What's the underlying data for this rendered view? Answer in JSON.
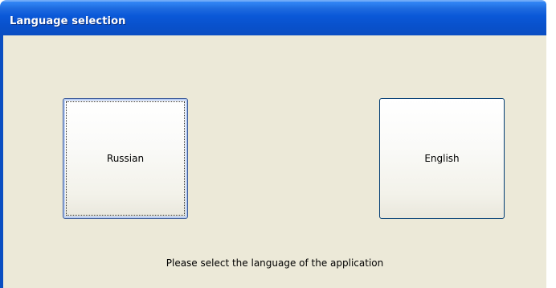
{
  "window": {
    "title": "Language selection"
  },
  "buttons": {
    "russian": "Russian",
    "english": "English"
  },
  "hint": "Please select the language of the application",
  "colors": {
    "titlebar": "#0a58d8",
    "client_background": "#ece9d8",
    "button_border": "#003c74",
    "title_text": "#ffffff"
  },
  "state": {
    "focused_button": "Russian"
  }
}
